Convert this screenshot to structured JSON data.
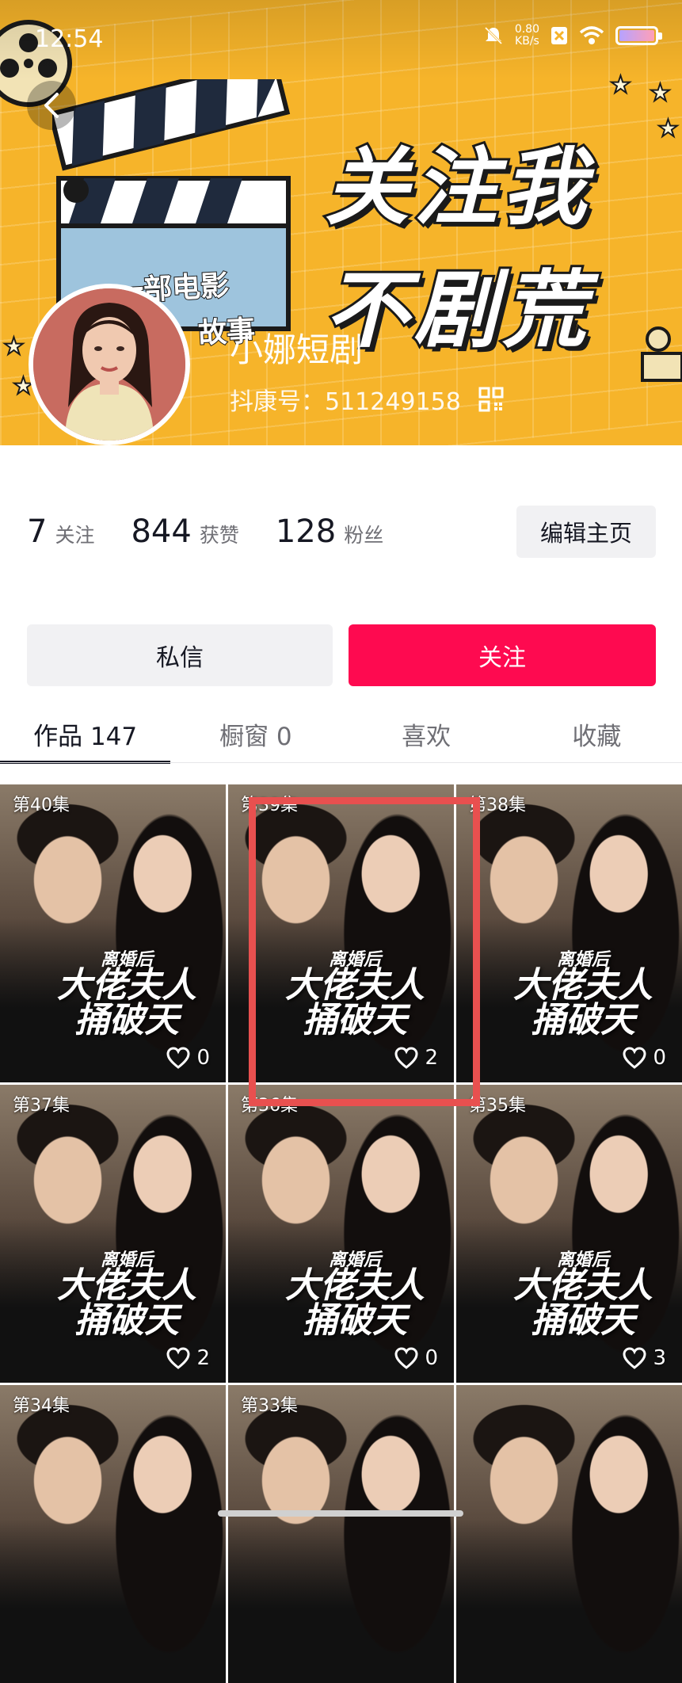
{
  "status_bar": {
    "time": "12:54",
    "net_speed_value": "0.80",
    "net_speed_unit": "KB/s",
    "icons": [
      "mute-icon",
      "sim-off-icon",
      "wifi-icon",
      "battery-icon"
    ]
  },
  "banner": {
    "slogan_line1": "关注我",
    "slogan_line2": "不剧荒",
    "clapper_text_1": "一部电影",
    "clapper_text_2": "故事"
  },
  "profile": {
    "nickname": "小娜短剧",
    "account_id": "抖康号：511249158"
  },
  "stats": {
    "following_count": "7",
    "following_label": "关注",
    "likes_count": "844",
    "likes_label": "获赞",
    "followers_count": "128",
    "followers_label": "粉丝"
  },
  "buttons": {
    "edit_profile": "编辑主页",
    "message": "私信",
    "follow": "关注"
  },
  "tabs": [
    {
      "label": "作品 147",
      "active": true
    },
    {
      "label": "橱窗 0",
      "active": false
    },
    {
      "label": "喜欢",
      "active": false
    },
    {
      "label": "收藏",
      "active": false
    }
  ],
  "videos": [
    {
      "episode": "第40集",
      "likes": "0",
      "title1": "离婚后",
      "title2": "大佬夫人",
      "title3": "捅破天"
    },
    {
      "episode": "第39集",
      "likes": "2",
      "title1": "离婚后",
      "title2": "大佬夫人",
      "title3": "捅破天"
    },
    {
      "episode": "第38集",
      "likes": "0",
      "title1": "离婚后",
      "title2": "大佬夫人",
      "title3": "捅破天"
    },
    {
      "episode": "第37集",
      "likes": "2",
      "title1": "离婚后",
      "title2": "大佬夫人",
      "title3": "捅破天"
    },
    {
      "episode": "第36集",
      "likes": "0",
      "title1": "离婚后",
      "title2": "大佬夫人",
      "title3": "捅破天"
    },
    {
      "episode": "第35集",
      "likes": "3",
      "title1": "离婚后",
      "title2": "大佬夫人",
      "title3": "捅破天"
    },
    {
      "episode": "第34集",
      "likes": "",
      "title1": "",
      "title2": "",
      "title3": ""
    },
    {
      "episode": "第33集",
      "likes": "",
      "title1": "",
      "title2": "",
      "title3": ""
    },
    {
      "episode": "",
      "likes": "",
      "title1": "",
      "title2": "",
      "title3": ""
    }
  ],
  "colors": {
    "banner_bg": "#F6B42A",
    "follow_button": "#FE0A50",
    "highlight_box": "#E8504F"
  }
}
